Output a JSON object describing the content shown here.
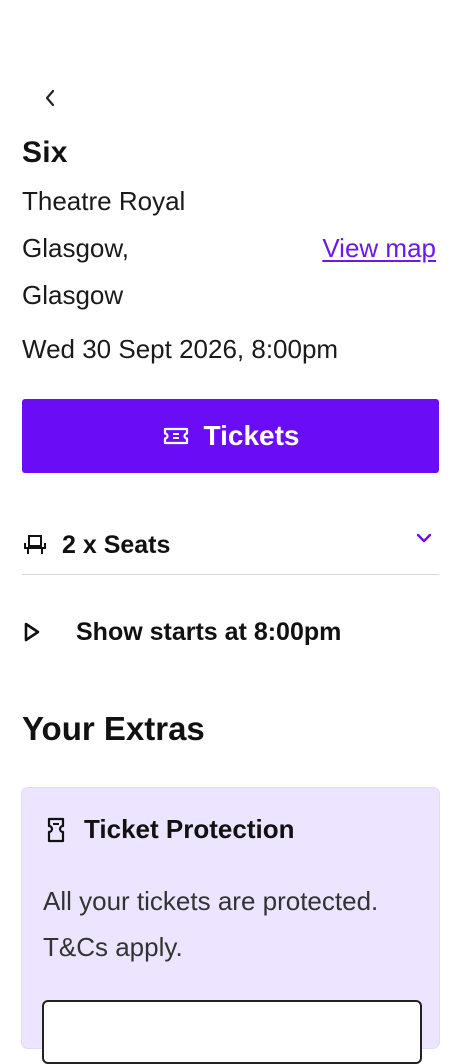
{
  "event": {
    "title": "Six",
    "venue_line1": "Theatre Royal",
    "venue_line2": "Glasgow,",
    "venue_line3": "Glasgow",
    "view_map_label": "View map",
    "datetime": "Wed 30 Sept 2026, 8:00pm"
  },
  "tickets_button": {
    "label": "Tickets",
    "icon": "ticket-icon"
  },
  "seats": {
    "label": "2 x Seats",
    "icon": "seat-icon",
    "chevron": "chevron-down-icon"
  },
  "show": {
    "label": "Show starts at 8:00pm",
    "icon": "play-icon"
  },
  "extras": {
    "heading": "Your Extras",
    "protection": {
      "title": "Ticket Protection",
      "text": "All your tickets are protected. T&Cs apply.",
      "icon": "ticket-protection-icon"
    }
  },
  "colors": {
    "accent": "#6a0df6",
    "link": "#6a1ae8",
    "card_bg": "#ede5ff"
  }
}
